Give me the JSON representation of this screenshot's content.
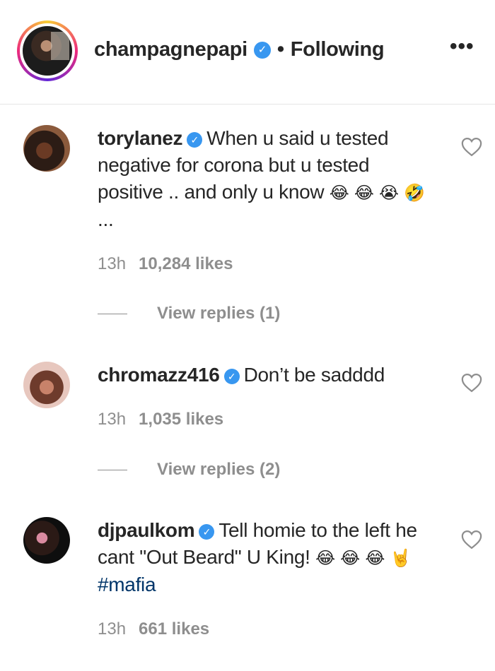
{
  "header": {
    "username": "champagnepapi",
    "verified_mark": "✓",
    "separator": "•",
    "follow_status": "Following",
    "more_label": "•••",
    "avatar_icon": "profile-avatar"
  },
  "comments": [
    {
      "username": "torylanez",
      "text": "When u said u tested negative for corona but u tested positive .. and only u know",
      "emojis": "😂 😂 😭 🤣",
      "trail": "...",
      "time": "13h",
      "likes": "10,284 likes",
      "replies_label": "View replies (1)"
    },
    {
      "username": "chromazz416",
      "text": "Don’t be sadddd",
      "time": "13h",
      "likes": "1,035 likes",
      "replies_label": "View replies (2)"
    },
    {
      "username": "djpaulkom",
      "text": "Tell homie to the left he cant \"Out Beard\" U King!",
      "emojis_1": "😂 😂",
      "emojis_2": "😂 🤘",
      "hashtag": "#mafia",
      "time": "13h",
      "likes": "661 likes"
    }
  ],
  "colors": {
    "verified": "#3897f0",
    "secondary_text": "#8e8e8e",
    "hashtag": "#003569"
  },
  "icons": [
    "more-options-icon",
    "verified-badge-icon",
    "heart-icon"
  ]
}
